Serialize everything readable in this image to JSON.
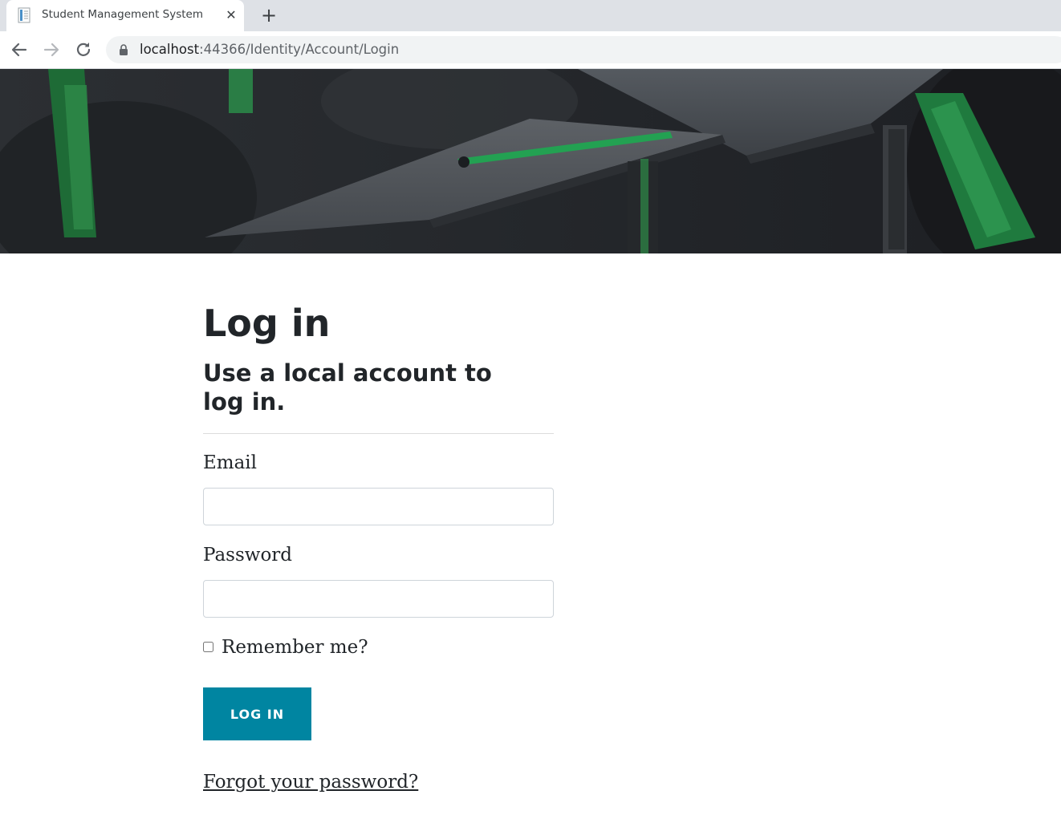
{
  "browser": {
    "tab_title": "Student Management System",
    "tab_close": "✕",
    "new_tab": "+",
    "url_host": "localhost",
    "url_rest": ":44366/Identity/Account/Login"
  },
  "hero": {
    "image": "graduation-caps-photo"
  },
  "login": {
    "title": "Log in",
    "subtitle": "Use a local account to log in.",
    "email_label": "Email",
    "email_value": "",
    "password_label": "Password",
    "password_value": "",
    "remember_label": "Remember me?",
    "remember_checked": false,
    "submit_label": "LOG IN",
    "forgot_link": "Forgot your password?"
  },
  "colors": {
    "button": "#0085a1",
    "text": "#212529",
    "tabstrip": "#dee1e6",
    "omnibox": "#f1f3f4"
  }
}
